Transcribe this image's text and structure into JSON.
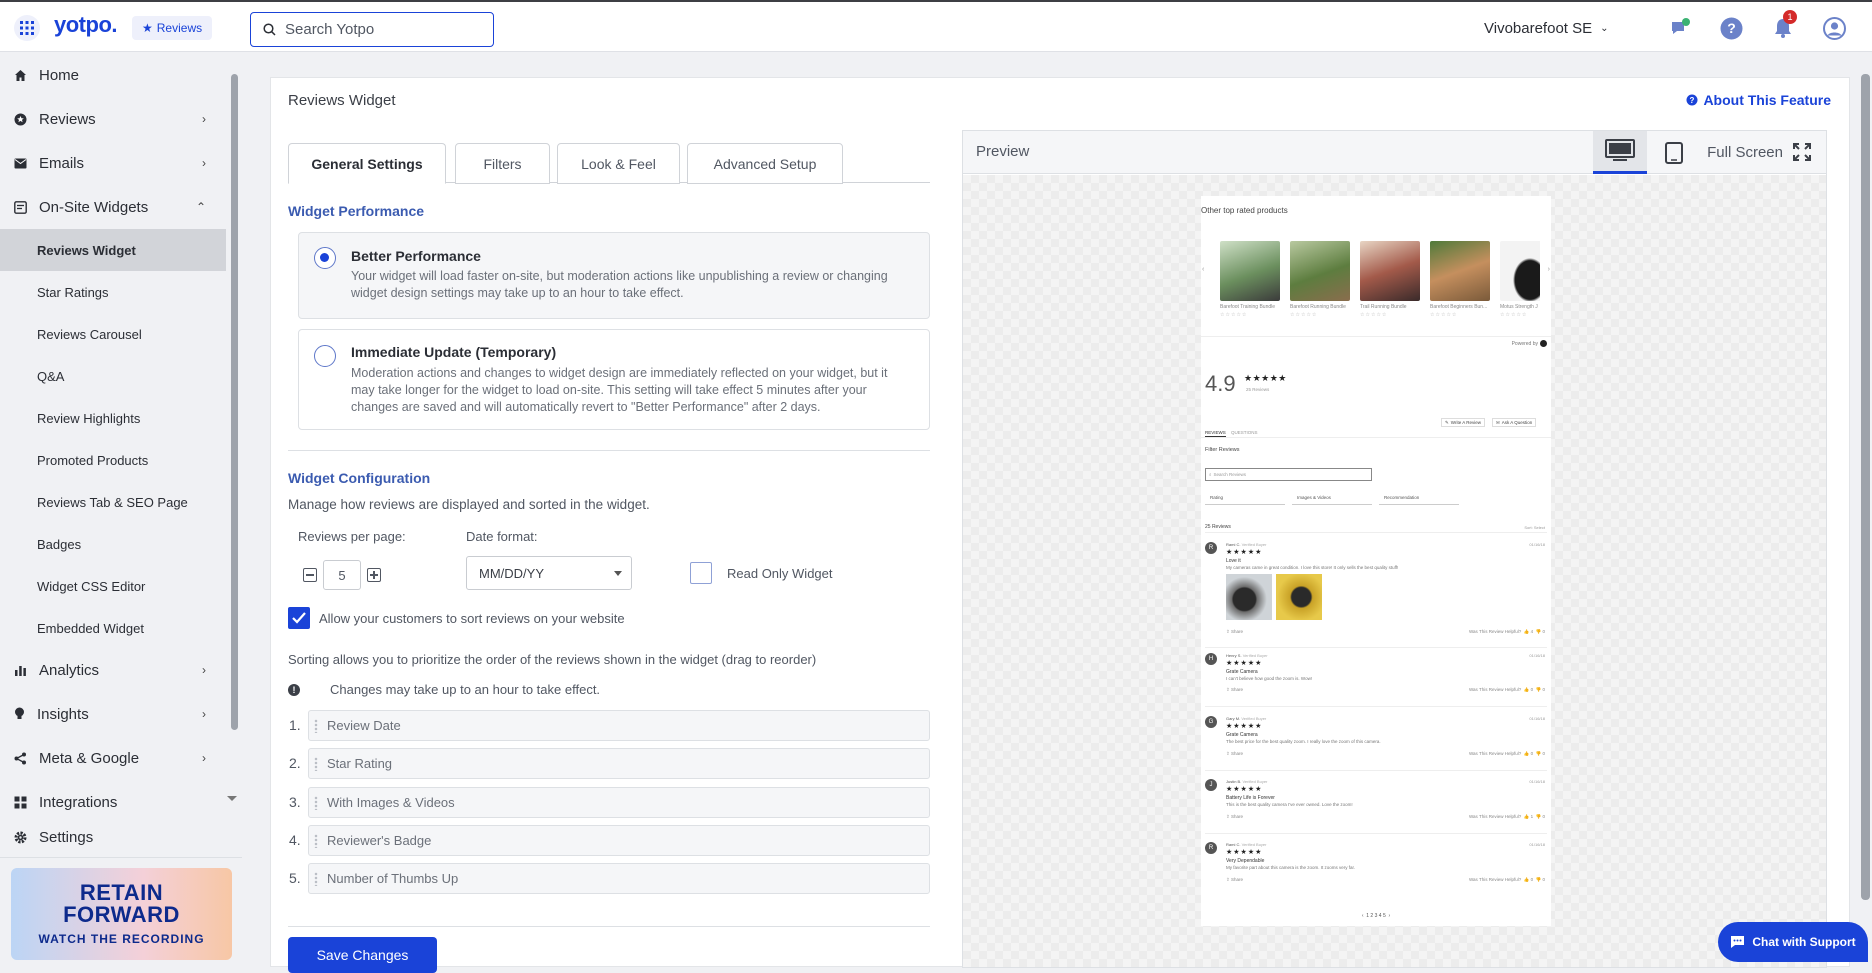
{
  "topbar": {
    "logo": "yotpo.",
    "app_pill": "Reviews",
    "search_placeholder": "Search Yotpo",
    "store_name": "Vivobarefoot SE",
    "notification_count": "1"
  },
  "sidebar": {
    "items": [
      {
        "label": "Home",
        "icon": "home-icon"
      },
      {
        "label": "Reviews",
        "icon": "star-circle-icon"
      },
      {
        "label": "Emails",
        "icon": "envelope-icon"
      },
      {
        "label": "On-Site Widgets",
        "icon": "widget-icon"
      }
    ],
    "sub_items": [
      "Reviews Widget",
      "Star Ratings",
      "Reviews Carousel",
      "Q&A",
      "Review Highlights",
      "Promoted Products",
      "Reviews Tab & SEO Page",
      "Badges",
      "Widget CSS Editor",
      "Embedded Widget"
    ],
    "active_sub": "Reviews Widget",
    "items_bottom": [
      {
        "label": "Analytics",
        "icon": "bar-chart-icon"
      },
      {
        "label": "Insights",
        "icon": "lightbulb-icon"
      },
      {
        "label": "Meta & Google",
        "icon": "share-icon"
      },
      {
        "label": "Integrations",
        "icon": "puzzle-icon"
      },
      {
        "label": "Settings",
        "icon": "gear-icon"
      }
    ],
    "promo": {
      "line1": "RETAIN",
      "line2": "FORWARD",
      "line3": "WATCH THE RECORDING"
    }
  },
  "main": {
    "title": "Reviews Widget",
    "about": "About This Feature",
    "tabs": [
      "General Settings",
      "Filters",
      "Look & Feel",
      "Advanced Setup"
    ],
    "active_tab": "General Settings",
    "performance": {
      "title": "Widget Performance",
      "options": [
        {
          "title": "Better Performance",
          "desc": "Your widget will load faster on-site, but moderation actions like unpublishing a review or changing widget design settings may take up to an hour to take effect.",
          "selected": true
        },
        {
          "title": "Immediate Update (Temporary)",
          "desc": "Moderation actions and changes to widget design are immediately reflected on your widget, but it may take longer for the widget to load on-site. This setting will take effect 5 minutes after your changes are saved and will automatically revert to \"Better Performance\" after 2 days.",
          "selected": false
        }
      ]
    },
    "config": {
      "title": "Widget Configuration",
      "subtitle": "Manage how reviews are displayed and sorted in the widget.",
      "reviews_per_page_label": "Reviews per page:",
      "reviews_per_page": "5",
      "date_format_label": "Date format:",
      "date_format": "MM/DD/YY",
      "read_only_label": "Read Only Widget",
      "allow_sort_label": "Allow your customers to sort reviews on your website",
      "sort_help": "Sorting allows you to prioritize the order of the reviews shown in the widget (drag to reorder)",
      "notice": "Changes may take up to an hour to take effect.",
      "sort_items": [
        {
          "num": "1.",
          "label": "Review Date"
        },
        {
          "num": "2.",
          "label": "Star Rating"
        },
        {
          "num": "3.",
          "label": "With Images & Videos"
        },
        {
          "num": "4.",
          "label": "Reviewer's Badge"
        },
        {
          "num": "5.",
          "label": "Number of Thumbs Up"
        }
      ]
    },
    "save_label": "Save Changes"
  },
  "preview": {
    "title": "Preview",
    "fullscreen": "Full Screen",
    "site": {
      "heading": "Other top rated products",
      "products": [
        "Barefoot Training Bundle",
        "Barefoot Running Bundle",
        "Trail Running Bundle",
        "Barefoot Beginners Bun...",
        "Motus Strength J"
      ],
      "powered": "Powered by",
      "score": "4.9",
      "score_stars": "★★★★★",
      "score_count": "25 Reviews",
      "write_review": "Write A Review",
      "ask_question": "Ask A Question",
      "tab_reviews": "REVIEWS",
      "tab_questions": "QUESTIONS",
      "filter_label": "Filter Reviews",
      "search_placeholder": "Search Reviews",
      "filters": [
        "Rating",
        "Images & Videos",
        "Recommendation"
      ],
      "count_label": "25 Reviews",
      "sort_label": "Sort: Select",
      "reviews": [
        {
          "initial": "R",
          "name": "Rami C.",
          "verified": "Verified Buyer",
          "date": "01/16/18",
          "title": "Love it",
          "body": "My cameras came in great condition. I love this store! It only sells the best quality stuff!",
          "helpful": "Was This Review Helpful?",
          "up": "4",
          "down": "0"
        },
        {
          "initial": "H",
          "name": "Henry S.",
          "verified": "Verified Buyer",
          "date": "01/16/18",
          "title": "Grate Camera",
          "body": "I can't believe how good the zoom is. Wow!",
          "helpful": "Was This Review Helpful?",
          "up": "0",
          "down": "0"
        },
        {
          "initial": "G",
          "name": "Gary M.",
          "verified": "Verified Buyer",
          "date": "01/16/18",
          "title": "Grate Camera",
          "body": "The best price for the best quality zoom. I really love the zoom of this camera.",
          "helpful": "Was This Review Helpful?",
          "up": "0",
          "down": "0"
        },
        {
          "initial": "J",
          "name": "Justin B.",
          "verified": "Verified Buyer",
          "date": "01/16/18",
          "title": "Battery Life is Forever",
          "body": "This is the best quality camera I've ever owned. Love the zoom!",
          "helpful": "Was This Review Helpful?",
          "up": "1",
          "down": "0"
        },
        {
          "initial": "R",
          "name": "Rami C.",
          "verified": "Verified Buyer",
          "date": "01/16/18",
          "title": "Very Dependable",
          "body": "My favorite part about this camera is the zoom. It zooms very far.",
          "helpful": "Was This Review Helpful?",
          "up": "0",
          "down": "0"
        }
      ],
      "share": "Share",
      "pagination": "1  2  3  4  5"
    }
  },
  "chat_label": "Chat with Support",
  "colors": {
    "accent": "#1a43d8",
    "section_title": "#3b5bb0",
    "badge_red": "#d42a2a"
  }
}
